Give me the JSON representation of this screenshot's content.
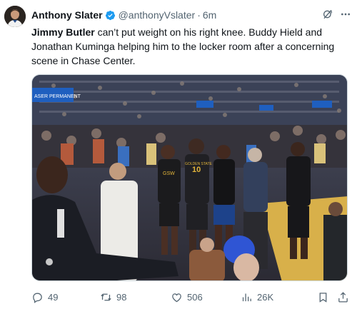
{
  "author": {
    "name": "Anthony Slater",
    "handle": "@anthonyVslater",
    "separator": "·",
    "time": "6m"
  },
  "tweet": {
    "text_bold": "Jimmy Butler",
    "text_rest": " can’t put weight on his right knee. Buddy Hield and Jonathan Kuminga helping him to the locker room after a concerning scene in Chase Center."
  },
  "media": {
    "jersey_number": "10",
    "jersey_text": "GOLDEN STATE",
    "arena_sign": "ASER PERMANENT"
  },
  "actions": {
    "replies": "49",
    "retweets": "98",
    "likes": "506",
    "views": "26K"
  },
  "colors": {
    "verified": "#1d9bf0",
    "muted_text": "#536471",
    "court": "#d8b04a",
    "warriors_blue": "#1d428a"
  },
  "icons": [
    "verified-badge-icon",
    "grok-icon",
    "more-icon",
    "reply-icon",
    "retweet-icon",
    "like-icon",
    "views-icon",
    "bookmark-icon",
    "share-icon"
  ]
}
